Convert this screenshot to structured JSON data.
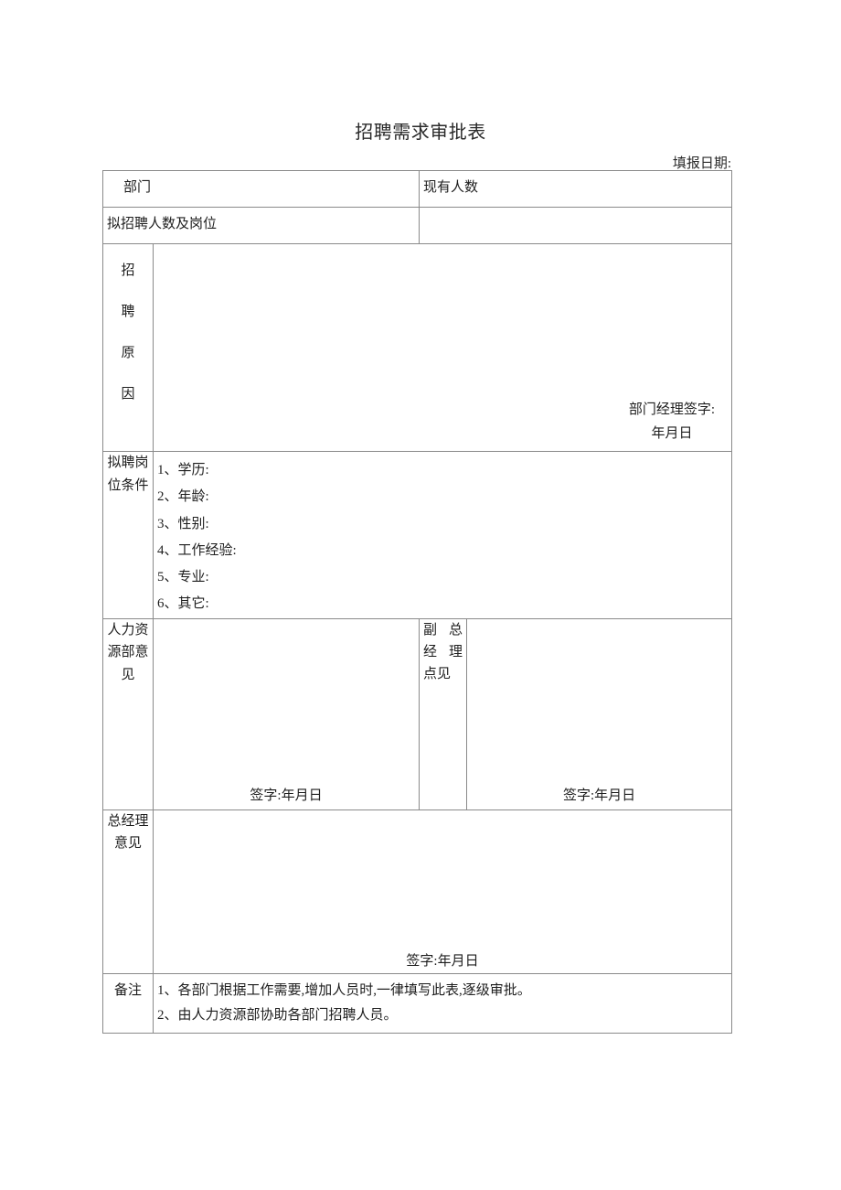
{
  "document": {
    "title": "招聘需求审批表",
    "fill_date_label": "填报日期:"
  },
  "table": {
    "row_department": {
      "label": "部门",
      "value": "",
      "right_label": "现有人数",
      "right_value": ""
    },
    "row_planned": {
      "label": "拟招聘人数及岗位",
      "value": "",
      "right_value": ""
    },
    "row_reason": {
      "label": "招聘原因",
      "label_chars": [
        "招",
        "聘",
        "原",
        "因"
      ],
      "content": "",
      "signature_label": "部门经理签字:",
      "date_label": "年月日"
    },
    "row_requirements": {
      "label": "拟聘岗位条件",
      "label_line1": "拟聘岗",
      "label_line2": "位条件",
      "items": [
        "1、学历:",
        "2、年龄:",
        "3、性别:",
        "4、工作经验:",
        "5、专业:",
        "6、其它:"
      ]
    },
    "row_opinions": {
      "hr": {
        "label": "人力资源部意见",
        "label_line1": "人力资",
        "label_line2": "源部意",
        "label_line3": "见",
        "content": "",
        "signature_label": "签字:年月日"
      },
      "deputy_gm": {
        "label": "副总经理点见",
        "label_line1": "副总",
        "label_line2": "经理",
        "label_line3": "点见",
        "content": "",
        "signature_label": "签字:年月日"
      }
    },
    "row_general_manager": {
      "label": "总经理意见",
      "label_line1": "总经理",
      "label_line2": "意见",
      "content": "",
      "signature_label": "签字:年月日"
    },
    "row_remarks": {
      "label": "备注",
      "items": [
        "1、各部门根据工作需要,增加人员时,一律填写此表,逐级审批。",
        "2、由人力资源部协助各部门招聘人员。"
      ]
    }
  },
  "colors": {
    "border": "#8a8a8a",
    "text": "#1e1e1e",
    "background": "#ffffff"
  }
}
